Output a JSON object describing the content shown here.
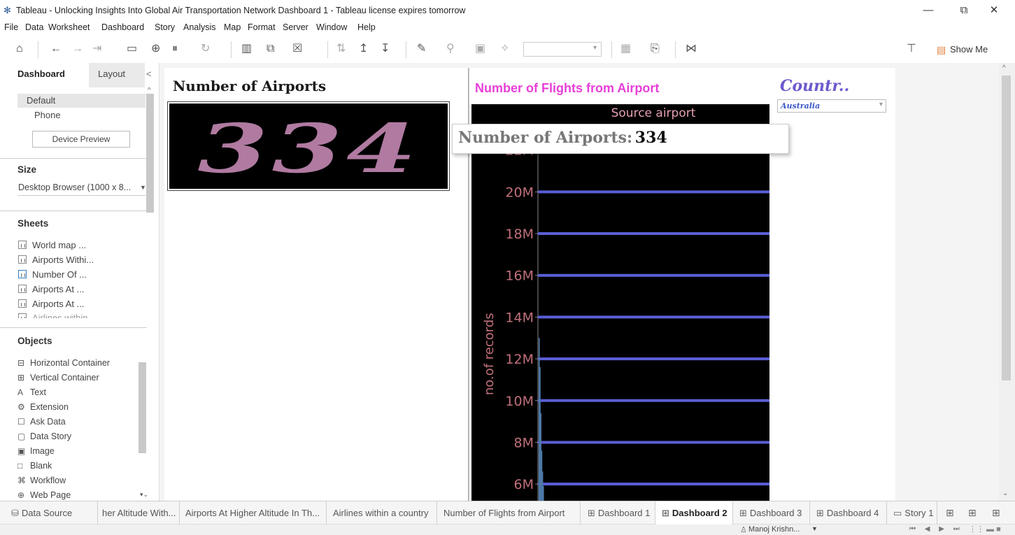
{
  "window": {
    "title": "Tableau - Unlocking Insights Into Global Air Transportation Network Dashboard 1 - Tableau license expires tomorrow",
    "minimize": "—",
    "restore": "⧉",
    "close": "✕"
  },
  "menu": [
    "File",
    "Data",
    "Worksheet",
    "Dashboard",
    "Story",
    "Analysis",
    "Map",
    "Format",
    "Server",
    "Window",
    "Help"
  ],
  "toolbar": {
    "show_me": "Show Me",
    "icons": [
      "home-icon",
      "back-icon",
      "forward-icon",
      "redo-icon",
      "save-icon",
      "new-datasource-icon",
      "pause-icon",
      "refresh-icon",
      "new-worksheet-icon",
      "duplicate-icon",
      "clear-icon",
      "swap-icon",
      "sort-asc-icon",
      "sort-desc-icon",
      "highlight-icon",
      "pin-icon",
      "label-icon",
      "fix-axes-icon",
      "fit-icon",
      "presentation-icon",
      "share-icon"
    ]
  },
  "left_panel": {
    "tab_dashboard": "Dashboard",
    "tab_layout": "Layout",
    "collapse": "<",
    "devices": [
      "Default",
      "Phone"
    ],
    "device_preview": "Device Preview",
    "size_heading": "Size",
    "size_value": "Desktop Browser (1000 x 8...",
    "sheets_heading": "Sheets",
    "sheets": [
      "World map ...",
      "Airports Withi...",
      "Number Of ...",
      "Airports At ...",
      "Airports At ...",
      "Airlines within ..."
    ],
    "objects_heading": "Objects",
    "objects": [
      {
        "icon": "horizontal-container-icon",
        "glyph": "⊟",
        "label": "Horizontal Container"
      },
      {
        "icon": "vertical-container-icon",
        "glyph": "⊞",
        "label": "Vertical Container"
      },
      {
        "icon": "text-icon",
        "glyph": "A",
        "label": "Text"
      },
      {
        "icon": "extension-icon",
        "glyph": "⚙",
        "label": "Extension"
      },
      {
        "icon": "ask-data-icon",
        "glyph": "☐",
        "label": "Ask Data"
      },
      {
        "icon": "data-story-icon",
        "glyph": "▢",
        "label": "Data Story"
      },
      {
        "icon": "image-icon",
        "glyph": "▣",
        "label": "Image"
      },
      {
        "icon": "blank-icon",
        "glyph": "□",
        "label": "Blank"
      },
      {
        "icon": "workflow-icon",
        "glyph": "⌘",
        "label": "Workflow"
      },
      {
        "icon": "web-page-icon",
        "glyph": "⊕",
        "label": "Web Page"
      }
    ]
  },
  "dashboard": {
    "kpi_title": "Number of Airports",
    "kpi_value": "334",
    "chart_title": "Number of  Flights from Airport",
    "tooltip_label": "Number of Airports:",
    "tooltip_value": "334",
    "filter_title": "Countr..",
    "filter_value": "Australia"
  },
  "chart_data": {
    "type": "bar",
    "title": "Source airport",
    "ylabel": "no.of records",
    "y_ticks": [
      "6M",
      "8M",
      "10M",
      "12M",
      "14M",
      "16M",
      "18M",
      "20M",
      "22M"
    ],
    "y_tick_values": [
      6,
      8,
      10,
      12,
      14,
      16,
      18,
      20,
      22
    ],
    "ylim": [
      5.2,
      24.2
    ],
    "unit": "M",
    "bar_values": [
      13.0,
      11.6,
      9.4,
      7.6,
      6.6,
      5.9
    ],
    "grid": true,
    "colors": {
      "background": "#000000",
      "gridline": "#5b5fd6",
      "bar": "#4e79a7",
      "text": "#c0707a",
      "title": "#e6a0b0"
    }
  },
  "sheet_tabs": [
    {
      "icon": "data-source-icon",
      "glyph": "⛁",
      "label": "Data Source",
      "active": false
    },
    {
      "icon": "",
      "glyph": "",
      "label": "her Altitude With...",
      "active": false
    },
    {
      "icon": "",
      "glyph": "",
      "label": "Airports At Higher Altitude In Th...",
      "active": false
    },
    {
      "icon": "",
      "glyph": "",
      "label": "Airlines within a country",
      "active": false
    },
    {
      "icon": "",
      "glyph": "",
      "label": "Number of  Flights from Airport",
      "active": false
    },
    {
      "icon": "dashboard-icon",
      "glyph": "⊞",
      "label": "Dashboard 1",
      "active": false
    },
    {
      "icon": "dashboard-icon",
      "glyph": "⊞",
      "label": "Dashboard 2",
      "active": true
    },
    {
      "icon": "dashboard-icon",
      "glyph": "⊞",
      "label": "Dashboard 3",
      "active": false
    },
    {
      "icon": "dashboard-icon",
      "glyph": "⊞",
      "label": "Dashboard 4",
      "active": false
    },
    {
      "icon": "story-icon",
      "glyph": "▭",
      "label": "Story 1",
      "active": false
    }
  ],
  "status": {
    "user": "Manoj Krishn...",
    "nav": "⏮ ◀ ▶ ⏭"
  }
}
